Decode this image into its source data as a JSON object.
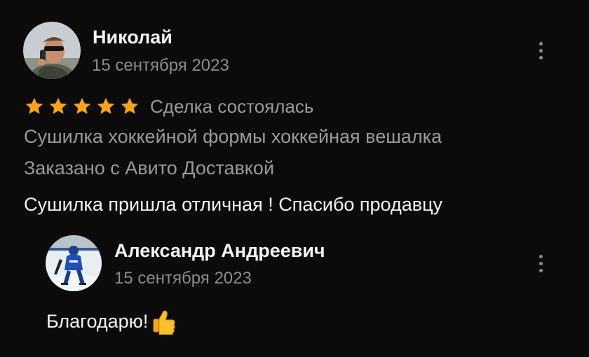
{
  "review": {
    "author": {
      "name": "Николай",
      "avatar_icon": "user-photo-avatar"
    },
    "date": "15 сентября 2023",
    "rating": 5,
    "rating_max": 5,
    "deal_status": "Сделка состоялась",
    "item_title": "Сушилка хоккейной формы хоккейная вешалка",
    "delivery_note": "Заказано с Авито Доставкой",
    "text": "Сушилка пришла отличная ! Спасибо продавцу",
    "menu_icon": "more-vertical-icon"
  },
  "reply": {
    "author": {
      "name": "Александр Андреевич",
      "avatar_icon": "hockey-player-avatar"
    },
    "date": "15 сентября 2023",
    "text": "Благодарю!",
    "emoji": "thumbs-up-icon",
    "menu_icon": "more-vertical-icon"
  },
  "colors": {
    "background": "#0b0b0b",
    "text_primary": "#f4f4f4",
    "text_secondary": "#9a9a9a",
    "star": "#f7a21b"
  }
}
